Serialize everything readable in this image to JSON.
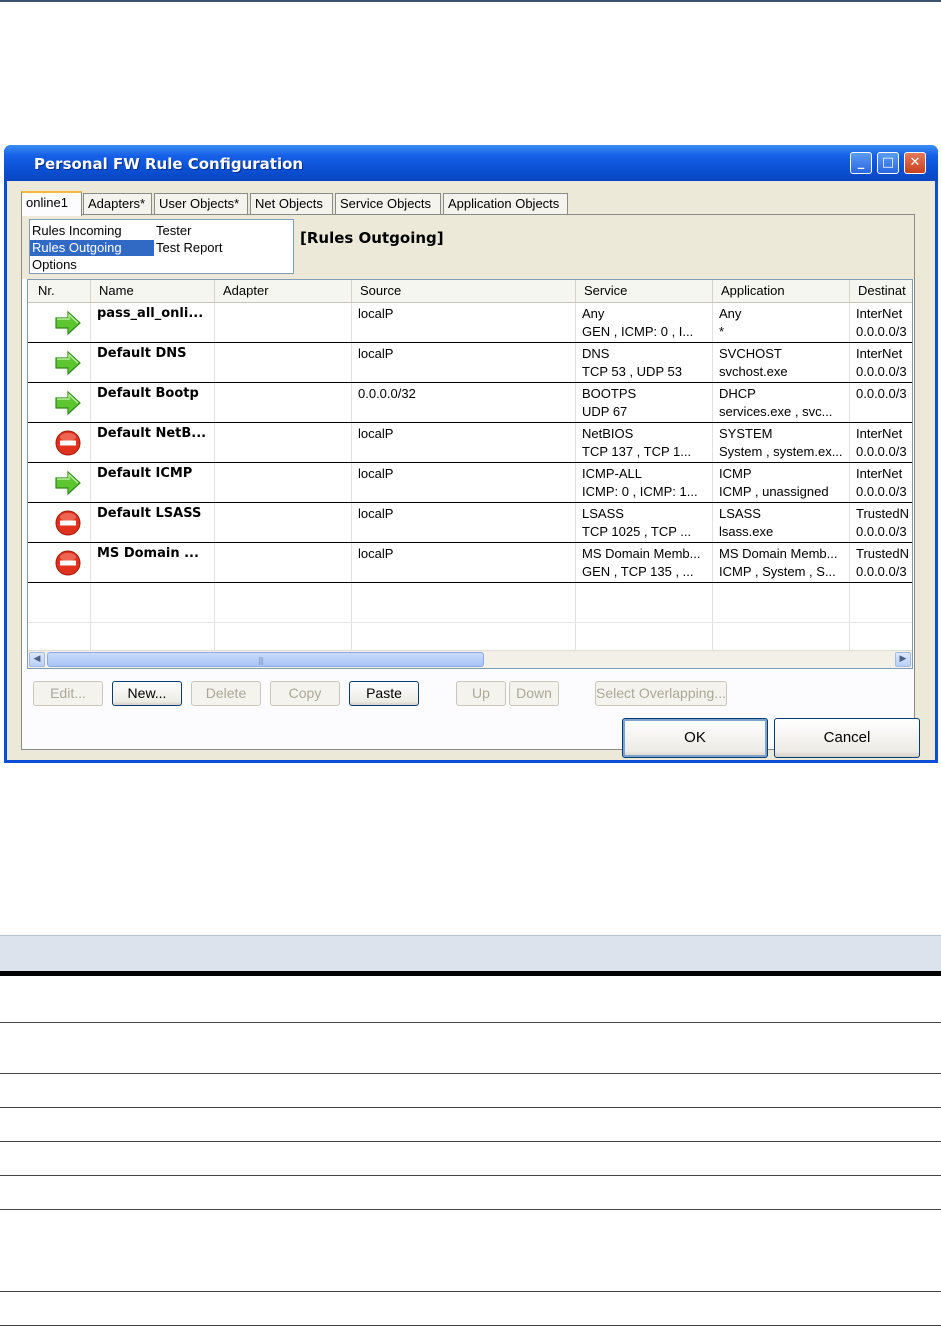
{
  "window": {
    "title": "Personal FW Rule Configuration",
    "controls": {
      "minimize": "_",
      "maximize": "□",
      "close": "✕"
    }
  },
  "tabs": [
    {
      "label": "online1",
      "active": true
    },
    {
      "label": "Adapters*"
    },
    {
      "label": "User Objects*"
    },
    {
      "label": "Net Objects"
    },
    {
      "label": "Service Objects"
    },
    {
      "label": "Application Objects"
    }
  ],
  "modes": {
    "rules_incoming": "Rules Incoming",
    "tester": "Tester",
    "rules_outgoing": "Rules Outgoing",
    "test_report": "Test Report",
    "options": "Options",
    "selected": "Rules Outgoing"
  },
  "section_title": "[Rules Outgoing]",
  "grid": {
    "columns": [
      "Nr.",
      "Name",
      "Adapter",
      "Source",
      "Service",
      "Application",
      "Destinat"
    ],
    "rows": [
      {
        "icon": "allow",
        "name": "pass_all_onli...",
        "adapter": "",
        "source": "localP",
        "service": [
          "Any",
          "GEN , ICMP: 0 , I..."
        ],
        "application": [
          "Any",
          "*"
        ],
        "destination": [
          "InterNet",
          "0.0.0.0/3"
        ]
      },
      {
        "icon": "allow",
        "name": "Default DNS",
        "adapter": "",
        "source": "localP",
        "service": [
          "DNS",
          "TCP 53 , UDP 53"
        ],
        "application": [
          "SVCHOST",
          "svchost.exe"
        ],
        "destination": [
          "InterNet",
          "0.0.0.0/3"
        ]
      },
      {
        "icon": "allow",
        "name": "Default Bootp",
        "adapter": "",
        "source": "0.0.0.0/32",
        "service": [
          "BOOTPS",
          "UDP 67"
        ],
        "application": [
          "DHCP",
          "services.exe , svc..."
        ],
        "destination": [
          "0.0.0.0/3",
          ""
        ]
      },
      {
        "icon": "block",
        "name": "Default NetB...",
        "adapter": "",
        "source": "localP",
        "service": [
          "NetBIOS",
          "TCP 137 , TCP 1..."
        ],
        "application": [
          "SYSTEM",
          "System , system.ex..."
        ],
        "destination": [
          "InterNet",
          "0.0.0.0/3"
        ]
      },
      {
        "icon": "allow",
        "name": "Default ICMP",
        "adapter": "",
        "source": "localP",
        "service": [
          "ICMP-ALL",
          "ICMP: 0 , ICMP: 1..."
        ],
        "application": [
          "ICMP",
          "ICMP , unassigned"
        ],
        "destination": [
          "InterNet",
          "0.0.0.0/3"
        ]
      },
      {
        "icon": "block",
        "name": "Default LSASS",
        "adapter": "",
        "source": "localP",
        "service": [
          "LSASS",
          "TCP 1025 , TCP ..."
        ],
        "application": [
          "LSASS",
          "lsass.exe"
        ],
        "destination": [
          "TrustedN",
          "0.0.0.0/3"
        ]
      },
      {
        "icon": "block",
        "name": "MS Domain ...",
        "adapter": "",
        "source": "localP",
        "service": [
          "MS Domain Memb...",
          "GEN , TCP 135 , ..."
        ],
        "application": [
          "MS Domain Memb...",
          "ICMP , System , S..."
        ],
        "destination": [
          "TrustedN",
          "0.0.0.0/3"
        ]
      }
    ],
    "scroll_grip": "|||"
  },
  "buttons": {
    "edit": "Edit...",
    "new": "New...",
    "delete": "Delete",
    "copy": "Copy",
    "paste": "Paste",
    "up": "Up",
    "down": "Down",
    "select_overlapping": "Select Overlapping...",
    "ok": "OK",
    "cancel": "Cancel"
  },
  "colors": {
    "titlebar": "#0b4fd6",
    "selection": "#316ac5",
    "allow_arrow": "#5cc531",
    "block_icon": "#e0301e",
    "dialog_face": "#ece9d8"
  }
}
